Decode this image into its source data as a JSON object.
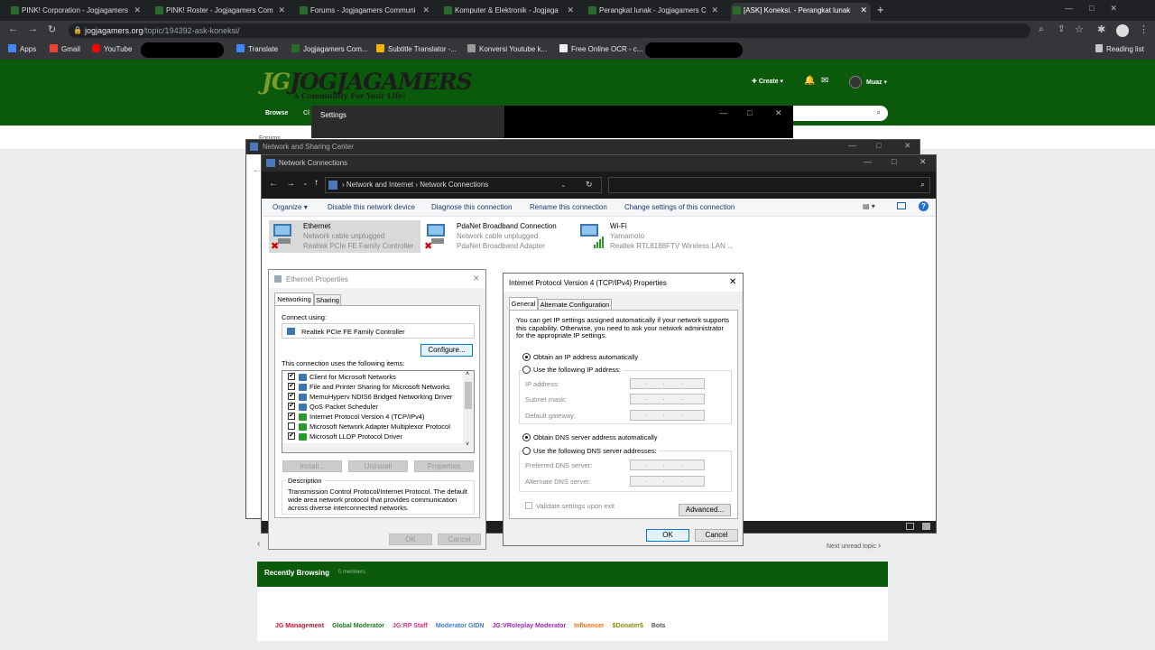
{
  "browser": {
    "tabs": [
      {
        "title": "PINK! Corporation - Jogjagamers"
      },
      {
        "title": "PINK! Roster - Jogjagamers Com"
      },
      {
        "title": "Forums - Jogjagamers Communi"
      },
      {
        "title": "Komputer & Elektronik - Jogjaga"
      },
      {
        "title": "Perangkat lunak - Jogjagamers C"
      },
      {
        "title": "[ASK] Koneksi. - Perangkat lunak"
      }
    ],
    "new_tab": "+",
    "url_host": "jogjagamers.org",
    "url_path": "/topic/194392-ask-koneksi/",
    "bookmarks": [
      {
        "label": "Apps",
        "color": "#4285f4"
      },
      {
        "label": "Gmail",
        "color": "#ea4335"
      },
      {
        "label": "YouTube",
        "color": "#ff0000"
      },
      {
        "label": "Translate",
        "color": "#4285f4"
      },
      {
        "label": "Jogjagamers Com...",
        "color": "#2a6b2a"
      },
      {
        "label": "Subtitle Translator -...",
        "color": "#f4b400"
      },
      {
        "label": "Konversi Youtube k...",
        "color": "#999999"
      },
      {
        "label": "Free Online OCR - c...",
        "color": "#eeeeee"
      }
    ],
    "reading_list": "Reading list"
  },
  "site": {
    "logo": "JOGJAGAMERS",
    "logo_mark": "JG",
    "tagline": "A Community For Your Life!",
    "create": "Create",
    "user": "Muaz",
    "nav_browse": "Browse",
    "nav_cl": "Cl",
    "breadcrumb": "Forums",
    "next_unread": "Next unread topic",
    "recently_browsing": "Recently Browsing",
    "members_count": "0 members",
    "legend": [
      {
        "label": "JG Management",
        "color": "#c8102e"
      },
      {
        "label": "Global Moderator",
        "color": "#1a7a1a"
      },
      {
        "label": "JG:RP Staff",
        "color": "#d63384"
      },
      {
        "label": "Moderator GIDN",
        "color": "#3d7bd9"
      },
      {
        "label": "JG:VRoleplay Moderator",
        "color": "#9c27b0"
      },
      {
        "label": "Influencer",
        "color": "#ff6a00"
      },
      {
        "label": "$Donater$",
        "color": "#8a8a00"
      },
      {
        "label": "Bots",
        "color": "#555555"
      }
    ]
  },
  "settings_window": {
    "title": "Settings"
  },
  "nsc_window": {
    "title": "Network and Sharing Center"
  },
  "network_connections": {
    "title": "Network Connections",
    "breadcrumb": [
      "Network and Internet",
      "Network Connections"
    ],
    "toolbar": [
      "Organize",
      "Disable this network device",
      "Diagnose this connection",
      "Rename this connection",
      "Change settings of this connection"
    ],
    "connections": [
      {
        "name": "Ethernet",
        "status": "Network cable unplugged",
        "device": "Realtek PCIe FE Family Controller"
      },
      {
        "name": "PdaNet Broadband Connection",
        "status": "Network cable unplugged",
        "device": "PdaNet Broadband Adapter"
      },
      {
        "name": "Wi-Fi",
        "status": "Yamamoto",
        "device": "Realtek RTL8188FTV Wireless LAN ..."
      }
    ]
  },
  "ethernet_props": {
    "title": "Ethernet Properties",
    "tabs": [
      "Networking",
      "Sharing"
    ],
    "connect_using_label": "Connect using:",
    "adapter": "Realtek PCIe FE Family Controller",
    "configure": "Configure...",
    "items_label": "This connection uses the following items:",
    "items": [
      {
        "label": "Client for Microsoft Networks",
        "checked": "✔"
      },
      {
        "label": "File and Printer Sharing for Microsoft Networks",
        "checked": "✔"
      },
      {
        "label": "MemuHyperv NDIS6 Bridged Networking Driver",
        "checked": "✔"
      },
      {
        "label": "QoS Packet Scheduler",
        "checked": "✔"
      },
      {
        "label": "Internet Protocol Version 4 (TCP/IPv4)",
        "checked": "✔"
      },
      {
        "label": "Microsoft Network Adapter Multiplexor Protocol",
        "checked": ""
      },
      {
        "label": "Microsoft LLDP Protocol Driver",
        "checked": "✔"
      }
    ],
    "install": "Install...",
    "uninstall": "Uninstall",
    "properties": "Properties",
    "description_label": "Description",
    "description": "Transmission Control Protocol/Internet Protocol. The default wide area network protocol that provides communication across diverse interconnected networks.",
    "ok": "OK",
    "cancel": "Cancel"
  },
  "ipv4_props": {
    "title": "Internet Protocol Version 4 (TCP/IPv4) Properties",
    "tabs": [
      "General",
      "Alternate Configuration"
    ],
    "intro": "You can get IP settings assigned automatically if your network supports this capability. Otherwise, you need to ask your network administrator for the appropriate IP settings.",
    "obtain_ip": "Obtain an IP address automatically",
    "use_ip": "Use the following IP address:",
    "ip_address": "IP address:",
    "subnet_mask": "Subnet mask:",
    "default_gateway": "Default gateway:",
    "obtain_dns": "Obtain DNS server address automatically",
    "use_dns": "Use the following DNS server addresses:",
    "preferred_dns": "Preferred DNS server:",
    "alternate_dns": "Alternate DNS server:",
    "validate": "Validate settings upon exit",
    "advanced": "Advanced...",
    "ok": "OK",
    "cancel": "Cancel",
    "ip_dots": ". . ."
  }
}
